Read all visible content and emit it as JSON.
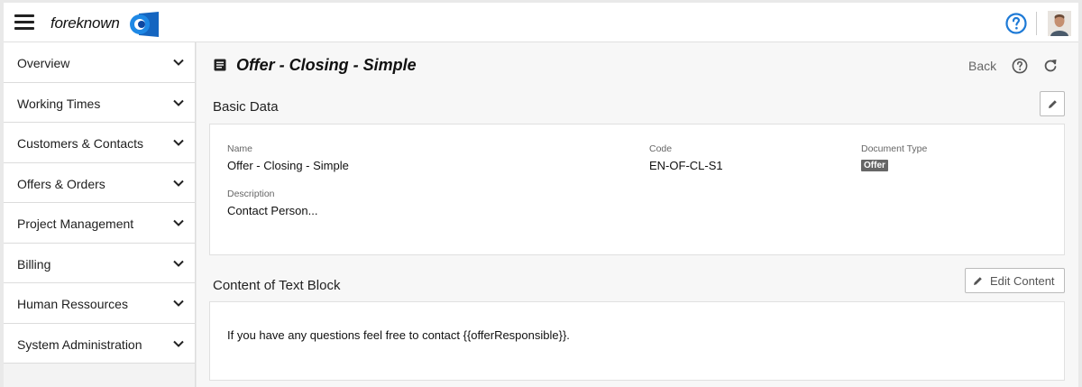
{
  "header": {
    "logo_text": "foreknown",
    "brand_color": "#1e7ad6"
  },
  "sidebar": {
    "items": [
      {
        "label": "Overview"
      },
      {
        "label": "Working Times"
      },
      {
        "label": "Customers & Contacts"
      },
      {
        "label": "Offers & Orders"
      },
      {
        "label": "Project Management"
      },
      {
        "label": "Billing"
      },
      {
        "label": "Human Ressources"
      },
      {
        "label": "System Administration"
      }
    ]
  },
  "page": {
    "title": "Offer - Closing - Simple",
    "back_label": "Back"
  },
  "basic_data": {
    "section_title": "Basic Data",
    "name_label": "Name",
    "name_value": "Offer - Closing - Simple",
    "code_label": "Code",
    "code_value": "EN-OF-CL-S1",
    "doctype_label": "Document Type",
    "doctype_value": "Offer",
    "description_label": "Description",
    "description_value": "Contact Person..."
  },
  "text_block": {
    "section_title": "Content of Text Block",
    "edit_label": "Edit Content",
    "content": "If you have any questions feel free to contact {{offerResponsible}}."
  }
}
